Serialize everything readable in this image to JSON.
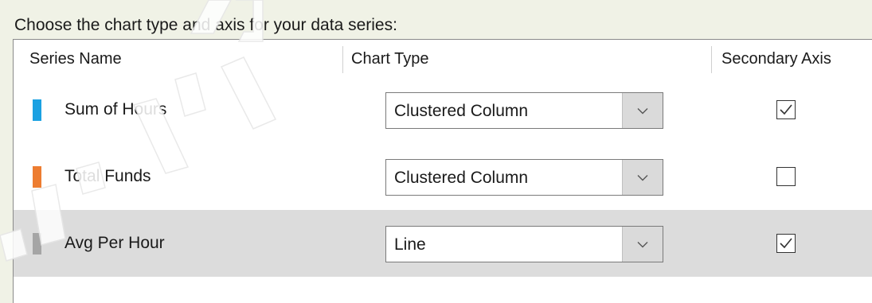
{
  "prompt": "Choose the chart type and axis for your data series:",
  "columns": {
    "series_name": "Series Name",
    "chart_type": "Chart Type",
    "secondary_axis": "Secondary Axis"
  },
  "rows": [
    {
      "series_name": "Sum of Hours",
      "color": "#1ba1e2",
      "chart_type": "Clustered Column",
      "secondary_axis": true,
      "selected": false
    },
    {
      "series_name": "Total Funds",
      "color": "#ed7d31",
      "chart_type": "Clustered Column",
      "secondary_axis": false,
      "selected": false
    },
    {
      "series_name": "Avg Per Hour",
      "color": "#a5a5a5",
      "chart_type": "Line",
      "secondary_axis": true,
      "selected": true
    }
  ],
  "icons": {
    "dropdown": "chevron-down-icon",
    "checkmark": "checkmark-icon",
    "watermark": "evaluation-watermark"
  },
  "colors": {
    "background": "#f0f2e6",
    "panel": "#ffffff",
    "selected_row": "#dcdcdc",
    "dropdown_button": "#dadada"
  },
  "watermark": {
    "text": "EVALUATION"
  }
}
